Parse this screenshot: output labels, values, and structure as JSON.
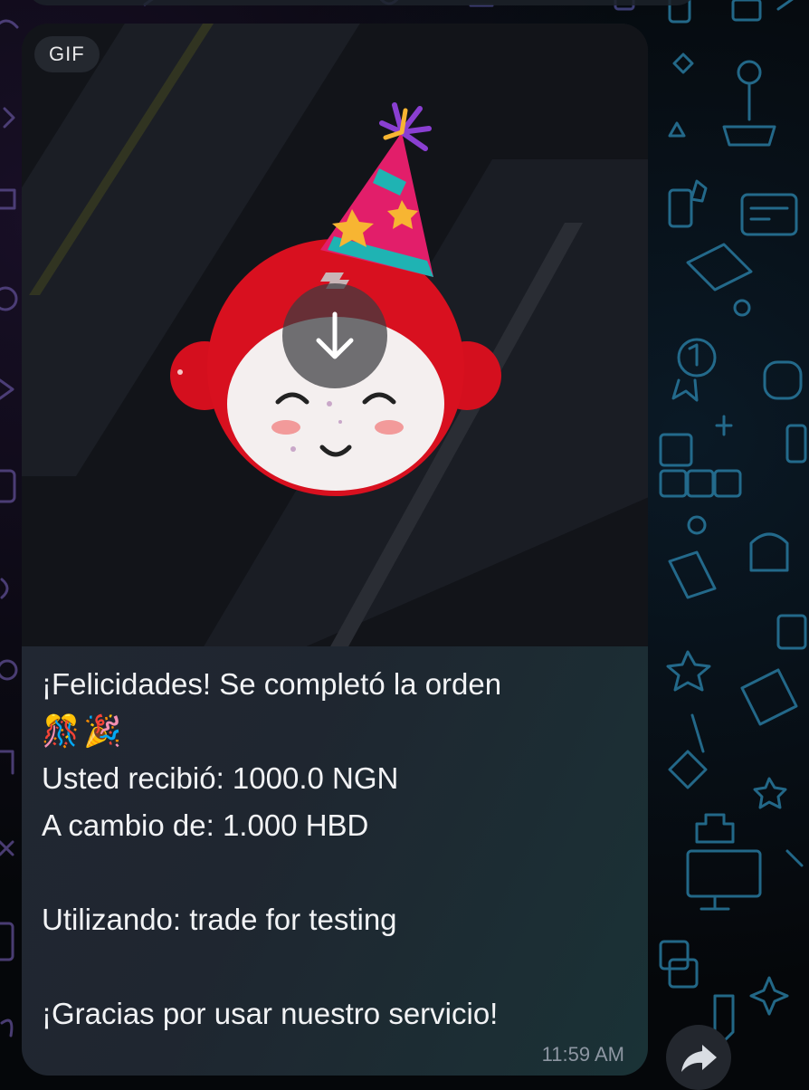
{
  "message": {
    "media_badge": "GIF",
    "caption_lines": [
      "¡Felicidades! Se completó la orden",
      "🎊🎉",
      "Usted recibió: 1000.0 NGN",
      "A cambio de: 1.000 HBD",
      "",
      "Utilizando: trade for testing",
      "",
      "¡Gracias por usar nuestro servicio!"
    ],
    "time": "11:59 AM"
  },
  "icons": {
    "download": "download-arrow-icon",
    "forward": "forward-share-icon"
  },
  "colors": {
    "bubble": "#232833",
    "wallpaper": "#05070a",
    "text": "#f2f3f5",
    "timestamp": "#8d96a2"
  }
}
